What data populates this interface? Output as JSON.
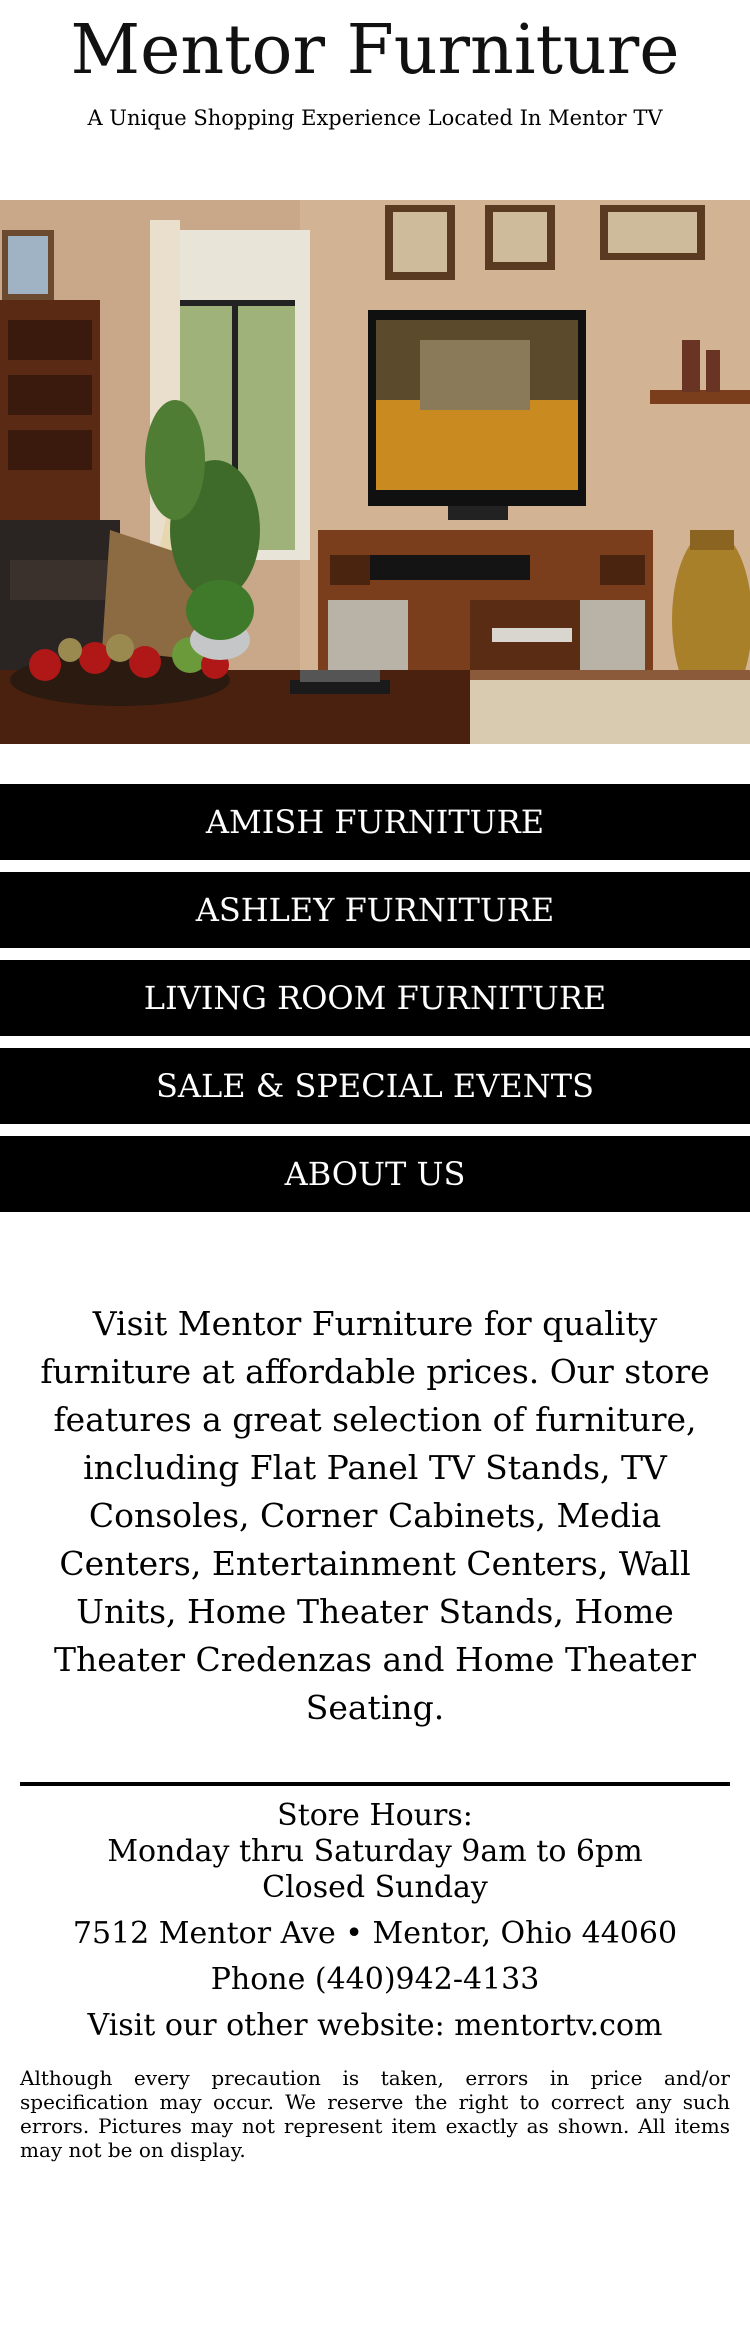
{
  "header": {
    "title": "Mentor Furniture",
    "tagline": "A Unique Shopping Experience Located In Mentor TV"
  },
  "hero": {
    "image_icon": "living-room-photo"
  },
  "nav": {
    "items": [
      {
        "label": "AMISH FURNITURE"
      },
      {
        "label": "ASHLEY FURNITURE"
      },
      {
        "label": "LIVING ROOM FURNITURE"
      },
      {
        "label": "SALE & SPECIAL EVENTS"
      },
      {
        "label": "ABOUT US"
      }
    ]
  },
  "intro": {
    "text": "Visit Mentor Furniture for quality furniture at affordable prices. Our store features a great selection of furniture, including Flat Panel TV Stands, TV Consoles, Corner Cabinets, Media Centers, Entertainment Centers, Wall Units, Home Theater Stands, Home Theater Credenzas and Home Theater Seating."
  },
  "footer": {
    "hours_title": "Store Hours:",
    "hours_weekday": "Monday thru Saturday 9am to 6pm",
    "hours_sunday": "Closed Sunday",
    "address": "7512 Mentor Ave • Mentor, Ohio 44060",
    "phone": "Phone (440)942-4133",
    "website": "Visit our other website: mentortv.com",
    "disclaimer": "Although every precaution is taken, errors in price and/or specification may occur. We reserve the right to correct any such errors. Pictures may not represent item exactly as shown. All items may not be on display."
  },
  "colors": {
    "nav_bg": "#000000",
    "nav_text": "#ffffff",
    "wall": "#c9a889",
    "wood": "#7a3e1c"
  }
}
